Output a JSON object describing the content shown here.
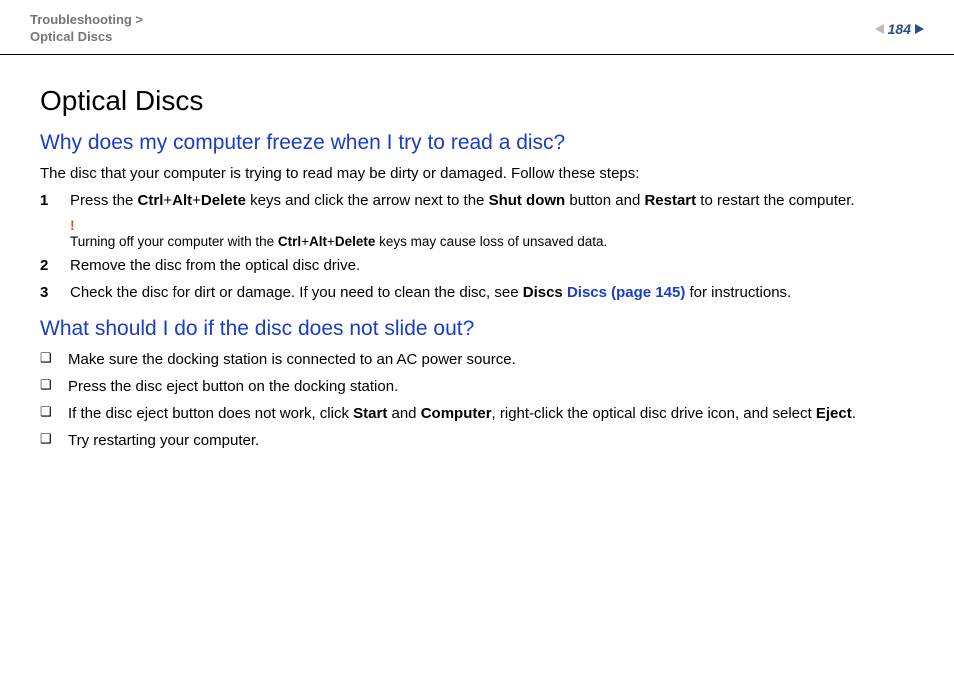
{
  "header": {
    "breadcrumb_top": "Troubleshooting >",
    "breadcrumb_bottom": "Optical Discs",
    "page_number": "184"
  },
  "title": "Optical Discs",
  "section1": {
    "heading": "Why does my computer freeze when I try to read a disc?",
    "intro": "The disc that your computer is trying to read may be dirty or damaged. Follow these steps:",
    "steps": [
      {
        "num": "1",
        "pre": "Press the ",
        "k1": "Ctrl",
        "plus1": "+",
        "k2": "Alt",
        "plus2": "+",
        "k3": "Delete",
        "mid1": " keys and click the arrow next to the ",
        "b1": "Shut down",
        "mid2": " button and ",
        "b2": "Restart",
        "post": " to restart the computer."
      },
      {
        "num": "2",
        "text": "Remove the disc from the optical disc drive."
      },
      {
        "num": "3",
        "pre": "Check the disc for dirt or damage. If you need to clean the disc, see ",
        "link_label": "Discs (page 145)",
        "post": " for instructions."
      }
    ],
    "note": {
      "mark": "!",
      "pre": "Turning off your computer with the ",
      "k1": "Ctrl",
      "plus1": "+",
      "k2": "Alt",
      "plus2": "+",
      "k3": "Delete",
      "post": " keys may cause loss of unsaved data."
    }
  },
  "section2": {
    "heading": "What should I do if the disc does not slide out?",
    "bullets": [
      {
        "text": "Make sure the docking station is connected to an AC power source."
      },
      {
        "text": "Press the disc eject button on the docking station."
      },
      {
        "pre": "If the disc eject button does not work, click ",
        "b1": "Start",
        "mid1": " and ",
        "b2": "Computer",
        "mid2": ", right-click the optical disc drive icon, and select ",
        "b3": "Eject",
        "post": "."
      },
      {
        "text": "Try restarting your computer."
      }
    ]
  },
  "glyphs": {
    "bullet": "❑"
  }
}
